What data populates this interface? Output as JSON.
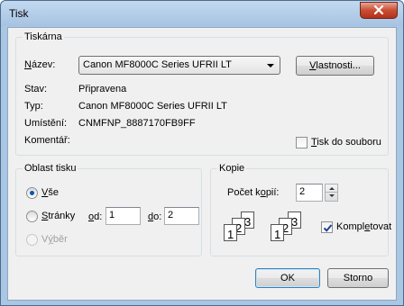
{
  "window": {
    "title": "Tisk"
  },
  "printer": {
    "group_title": "Tiskárna",
    "name_label_u": "N",
    "name_label_rest": "ázev:",
    "name_value": "Canon MF8000C Series UFRII LT",
    "properties_prefix": "",
    "properties_u": "V",
    "properties_rest": "lastnosti...",
    "status_label": "Stav:",
    "status_value": "Připravena",
    "type_label": "Typ:",
    "type_value": "Canon MF8000C Series UFRII LT",
    "location_label": "Umístění:",
    "location_value": "CNMFNP_8887170FB9FF",
    "comment_label": "Komentář:",
    "print_to_file_u": "T",
    "print_to_file_rest": "isk do souboru",
    "print_to_file_checked": false
  },
  "range": {
    "group_title": "Oblast tisku",
    "all_prefix": "",
    "all_u": "V",
    "all_rest": "še",
    "all_selected": true,
    "pages_u": "S",
    "pages_rest": "tránky",
    "from_u": "o",
    "from_rest": "d:",
    "from_value": "1",
    "to_u": "d",
    "to_rest": "o:",
    "to_value": "2",
    "selection_prefix": "V",
    "selection_u": "ý",
    "selection_rest": "běr"
  },
  "copies": {
    "group_title": "Kopie",
    "count_label_pre": "Počet k",
    "count_label_u": "o",
    "count_label_rest": "pií:",
    "count_value": "2",
    "collate_pre": "Kompl",
    "collate_u": "e",
    "collate_rest": "tovat",
    "collate_checked": true,
    "page_numbers": [
      "1",
      "2",
      "3"
    ]
  },
  "buttons": {
    "ok": "OK",
    "cancel": "Storno"
  },
  "colors": {
    "check_blue": "#1c3f94",
    "close_red": "#c84d33"
  }
}
